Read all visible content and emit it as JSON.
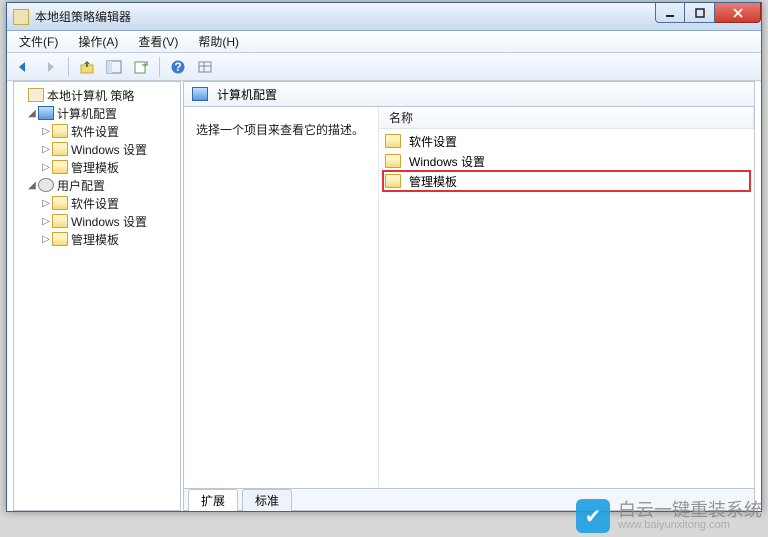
{
  "window": {
    "title": "本地组策略编辑器"
  },
  "menu": {
    "file": "文件(F)",
    "action": "操作(A)",
    "view": "查看(V)",
    "help": "帮助(H)"
  },
  "tree": {
    "root": "本地计算机 策略",
    "computer": "计算机配置",
    "user": "用户配置",
    "children": {
      "software": "软件设置",
      "windows": "Windows 设置",
      "templates": "管理模板"
    }
  },
  "main": {
    "heading": "计算机配置",
    "description": "选择一个项目来查看它的描述。",
    "column_name": "名称",
    "items": [
      {
        "label": "软件设置"
      },
      {
        "label": "Windows 设置"
      },
      {
        "label": "管理模板"
      }
    ],
    "highlighted_index": 2,
    "tabs": {
      "extended": "扩展",
      "standard": "标准"
    }
  },
  "watermark": {
    "brand": "白云一键重装系统",
    "url": "www.baiyunxitong.com"
  }
}
